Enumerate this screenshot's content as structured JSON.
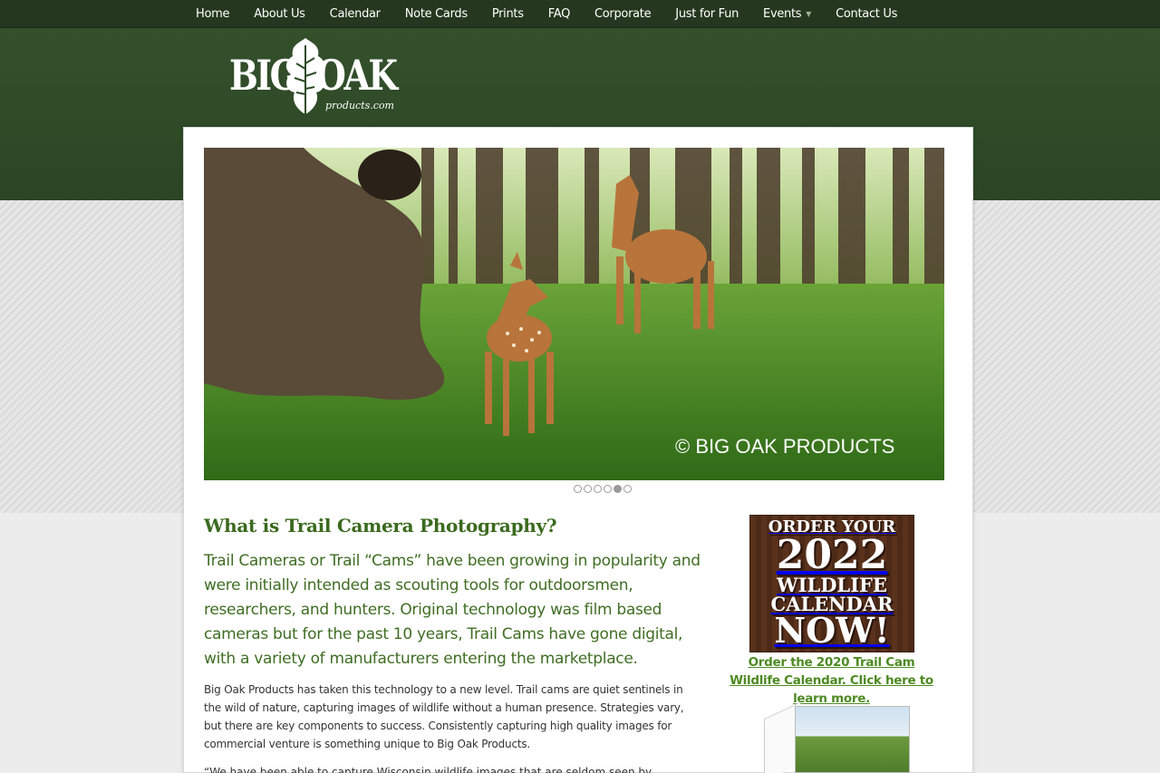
{
  "nav": {
    "items": [
      {
        "label": "Home"
      },
      {
        "label": "About Us"
      },
      {
        "label": "Calendar"
      },
      {
        "label": "Note Cards"
      },
      {
        "label": "Prints"
      },
      {
        "label": "FAQ"
      },
      {
        "label": "Corporate"
      },
      {
        "label": "Just for Fun"
      },
      {
        "label": "Events",
        "has_dropdown": true
      },
      {
        "label": "Contact Us"
      }
    ]
  },
  "logo": {
    "big": "BIG",
    "oak": "OAK",
    "domain": "products.com"
  },
  "hero": {
    "watermark": "© BIG OAK PRODUCTS",
    "slide_count": 6,
    "active_slide": 5
  },
  "content": {
    "title": "What is Trail Camera Photography?",
    "lead": "Trail Cameras or Trail “Cams” have been growing in popularity and were initially intended as scouting tools for outdoorsmen, researchers, and hunters. Original technology was film based cameras but for the past 10 years, Trail Cams have gone digital, with a variety of manufacturers entering the marketplace.",
    "body": "Big Oak Products has taken this technology to a new level. Trail cams are quiet sentinels in the wild of nature, capturing images of wildlife without a human presence. Strategies vary, but there are key components to success. Consistently capturing high quality images for commercial venture is something unique to Big Oak Products.",
    "quote": "“We have been able to capture Wisconsin wildlife images that are seldom seen by humans. An"
  },
  "sidebar": {
    "promo_lines": [
      "ORDER YOUR",
      "2022",
      "WILDLIFE CALENDAR",
      "NOW!"
    ],
    "promo_caption": "Order the 2020 Trail Cam Wildlife Calendar. Click here to learn more."
  },
  "colors": {
    "header": "#2e4a27",
    "nav": "#25381f",
    "accent_green": "#3f6d23"
  }
}
